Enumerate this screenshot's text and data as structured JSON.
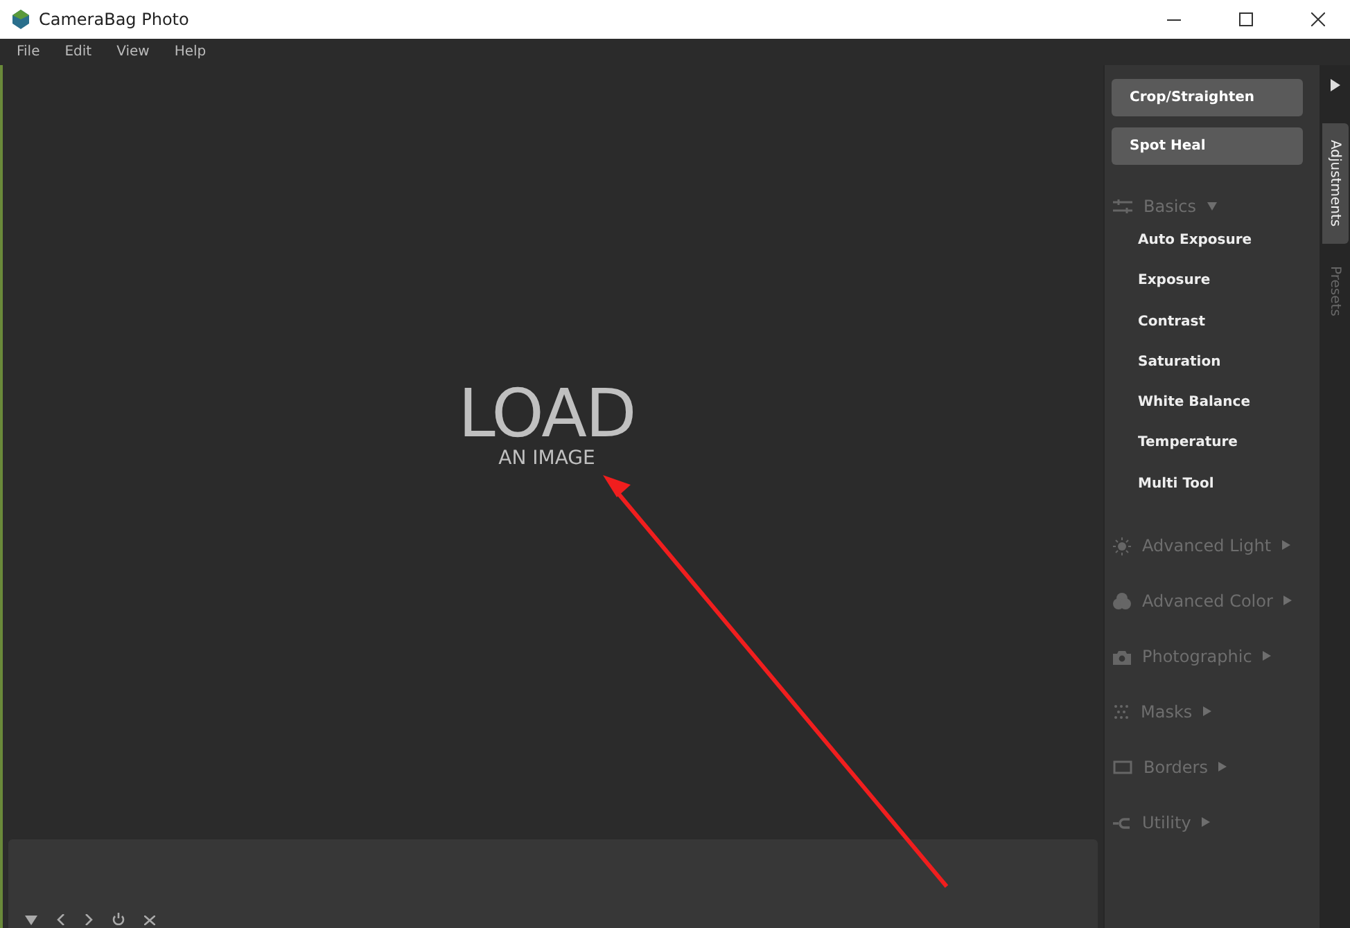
{
  "window": {
    "title": "CameraBag Photo"
  },
  "menu": [
    "File",
    "Edit",
    "View",
    "Help"
  ],
  "canvas": {
    "headline": "LOAD",
    "subline": "AN IMAGE"
  },
  "panel": {
    "tools": [
      "Crop/Straighten",
      "Spot Heal"
    ],
    "sections": [
      {
        "label": "Basics",
        "kind": "sliders",
        "expanded": true,
        "items": [
          "Auto Exposure",
          "Exposure",
          "Contrast",
          "Saturation",
          "White Balance",
          "Temperature",
          "Multi Tool"
        ]
      },
      {
        "label": "Advanced Light",
        "kind": "sun",
        "expanded": false
      },
      {
        "label": "Advanced Color",
        "kind": "color",
        "expanded": false
      },
      {
        "label": "Photographic",
        "kind": "camera",
        "expanded": false
      },
      {
        "label": "Masks",
        "kind": "masks",
        "expanded": false
      },
      {
        "label": "Borders",
        "kind": "border",
        "expanded": false
      },
      {
        "label": "Utility",
        "kind": "utility",
        "expanded": false
      }
    ]
  },
  "side_tabs": [
    {
      "label": "Adjustments",
      "selected": true
    },
    {
      "label": "Presets",
      "selected": false
    }
  ]
}
